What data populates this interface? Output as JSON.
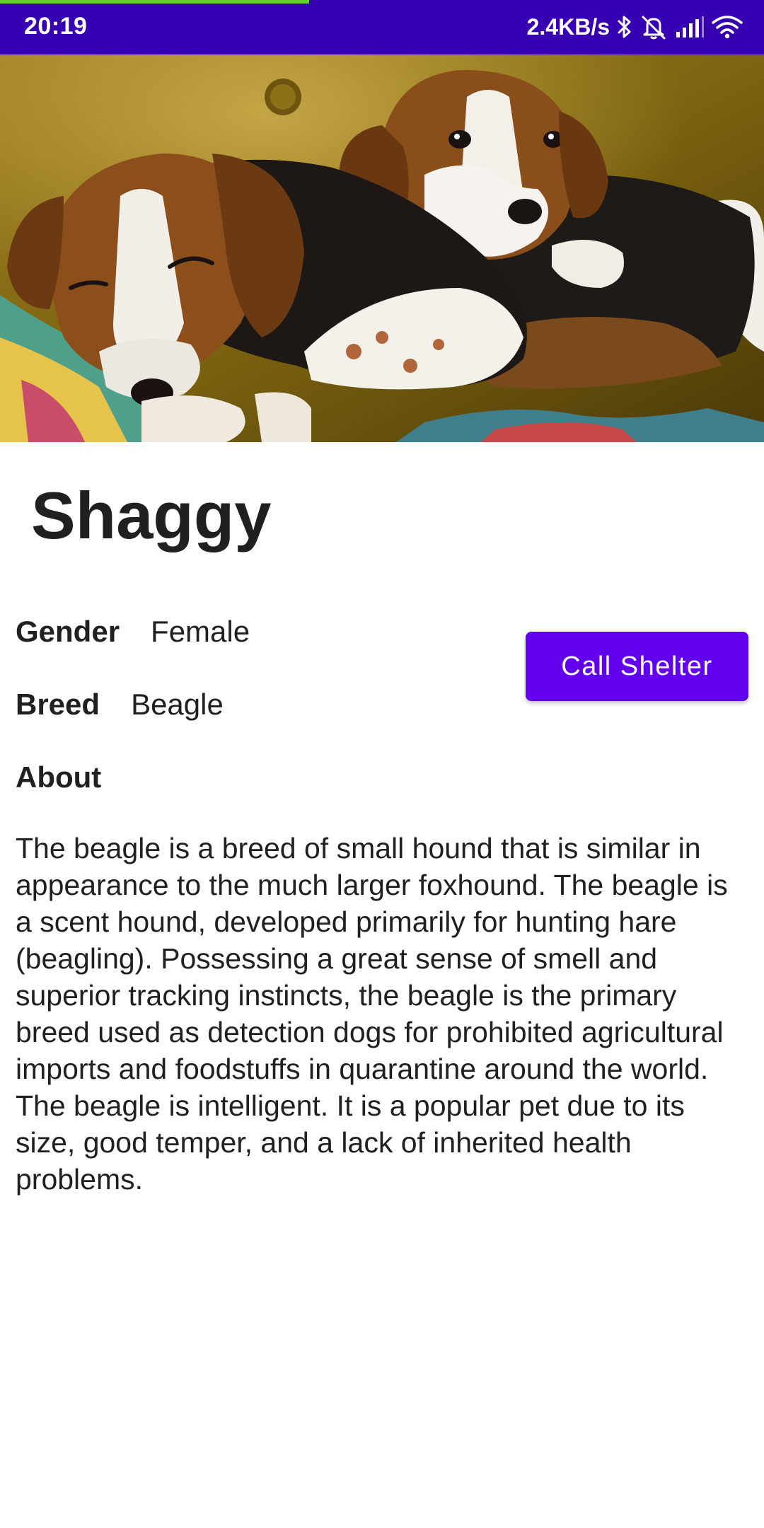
{
  "status_bar": {
    "time": "20:19",
    "net_speed": "2.4KB/s",
    "background_color": "#3700b3",
    "load_progress": 0.405,
    "load_progress_color": "#5fd12a",
    "icons": [
      "bluetooth-icon",
      "alarm-off-icon",
      "signal-icon",
      "wifi-icon"
    ]
  },
  "pet": {
    "name": "Shaggy",
    "gender_label": "Gender",
    "gender": "Female",
    "breed_label": "Breed",
    "breed": "Beagle",
    "about_label": "About",
    "about": "The beagle is a breed of small hound that is similar in appearance to the much larger foxhound. The beagle is a scent hound, developed primarily for hunting hare (beagling). Possessing a great sense of smell and superior tracking instincts, the beagle is the primary breed used as detection dogs for prohibited agricultural imports and foodstuffs in quarantine around the world. The beagle is intelligent. It is a popular pet due to its size, good temper, and a lack of inherited health problems."
  },
  "actions": {
    "call_shelter_label": "Call Shelter",
    "accent_color": "#6200ee"
  }
}
